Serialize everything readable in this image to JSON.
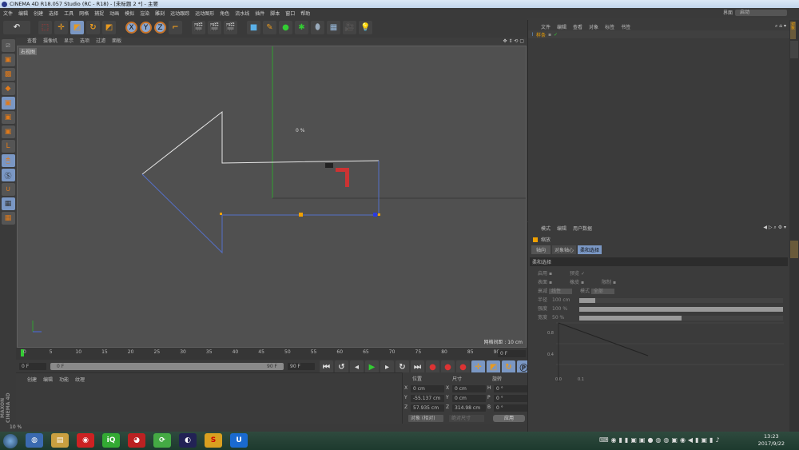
{
  "title": "CINEMA 4D R18.057 Studio (RC - R18) - [未标题 2 *] - 主要",
  "menu": [
    "文件",
    "编辑",
    "创建",
    "选择",
    "工具",
    "网格",
    "捕捉",
    "动画",
    "模拟",
    "渲染",
    "雕刻",
    "运动跟踪",
    "运动图形",
    "角色",
    "流水线",
    "插件",
    "脚本",
    "窗口",
    "帮助"
  ],
  "layout": {
    "label": "界面",
    "value": "启动"
  },
  "viewport": {
    "menu": [
      "查看",
      "摄像机",
      "显示",
      "选项",
      "过滤",
      "面板"
    ],
    "label": "右视图",
    "percent": "0 %",
    "grid_spacing": "网格间距 : 10 cm"
  },
  "timeline": {
    "ticks": [
      "0",
      "5",
      "10",
      "15",
      "20",
      "25",
      "30",
      "35",
      "40",
      "45",
      "50",
      "55",
      "60",
      "65",
      "70",
      "75",
      "80",
      "85",
      "90"
    ],
    "end_frame": "0 F",
    "current": "0 F",
    "range_start": "0 F",
    "range_end": "90 F",
    "max": "90 F"
  },
  "material": {
    "menu": [
      "创建",
      "编辑",
      "功能",
      "纹理"
    ]
  },
  "coords": {
    "headers": [
      "位置",
      "尺寸",
      "旋转"
    ],
    "rows": [
      {
        "a": "X",
        "pos": "0 cm",
        "b": "X",
        "size": "0 cm",
        "c": "H",
        "rot": "0 °"
      },
      {
        "a": "Y",
        "pos": "-55.137 cm",
        "b": "Y",
        "size": "0 cm",
        "c": "P",
        "rot": "0 °"
      },
      {
        "a": "Z",
        "pos": "57.935 cm",
        "b": "Z",
        "size": "314.98 cm",
        "c": "B",
        "rot": "0 °"
      }
    ],
    "mode": "对象 (相对)",
    "size_mode": "绝对尺寸",
    "apply": "应用"
  },
  "objects": {
    "menu": [
      "文件",
      "编辑",
      "查看",
      "对象",
      "标签",
      "书签"
    ],
    "item": "样条"
  },
  "attributes": {
    "menu": [
      "模式",
      "编辑",
      "用户数据"
    ],
    "tool": "缩放",
    "tabs": [
      "轴向",
      "对象轴心",
      "柔和选择"
    ],
    "active_tab": 2,
    "section": "柔和选择",
    "enable": "启用",
    "preview": "预览",
    "surface": "表面",
    "rubber": "橡皮",
    "restrict": "限制",
    "falloff_label": "衰减",
    "falloff": "线性",
    "mode_label": "模式",
    "mode": "全部",
    "radius_label": "半径",
    "radius": "100 cm",
    "strength_label": "强度",
    "strength": "100 %",
    "width_label": "宽度",
    "width": "50 %",
    "strength_fill": 1.0,
    "width_fill": 0.5,
    "radius_fill": 0.08,
    "graph": {
      "y_ticks": [
        "0.8",
        "0.4"
      ],
      "x_ticks": [
        "0.0",
        "0.1"
      ]
    }
  },
  "status": "10 %",
  "clock": {
    "time": "13:23",
    "date": "2017/9/22"
  },
  "colors": {
    "accent": "#7a97c4",
    "spline": "#e6e6e6",
    "selected": "#5570c8",
    "y_axis": "#2fa02f",
    "point": "#f0a000"
  }
}
